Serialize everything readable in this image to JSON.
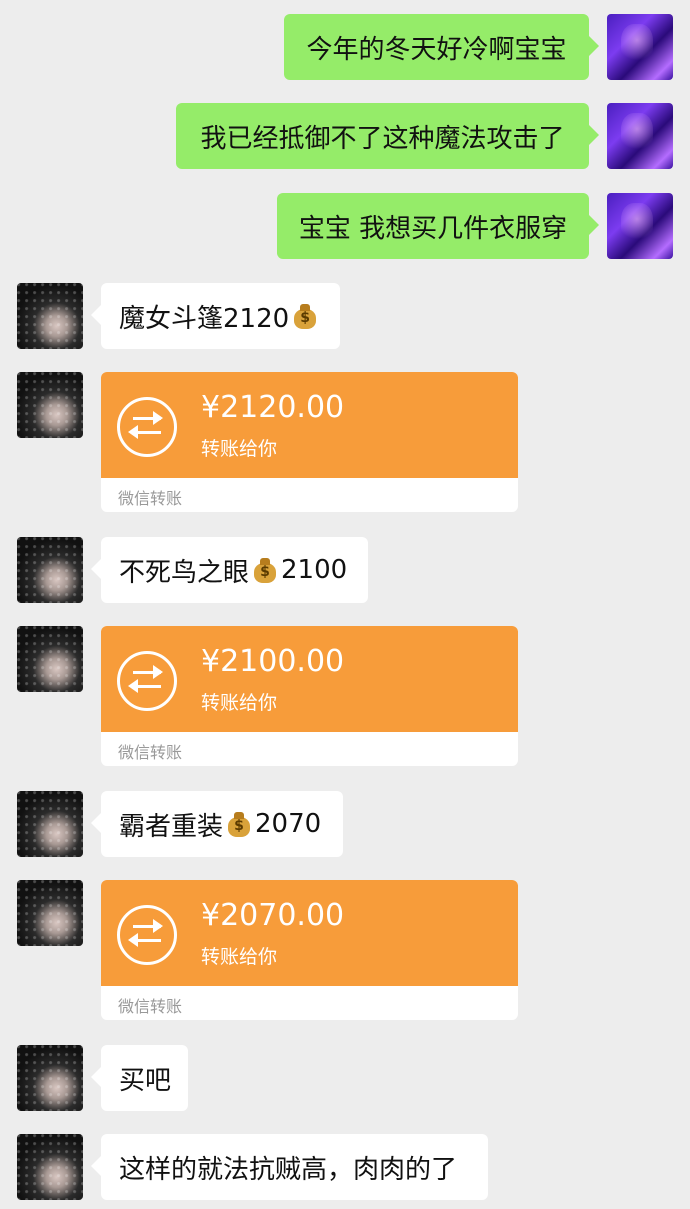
{
  "messages": [
    {
      "side": "me",
      "type": "text",
      "text": "今年的冬天好冷啊宝宝"
    },
    {
      "side": "me",
      "type": "text",
      "text": "我已经抵御不了这种魔法攻击了"
    },
    {
      "side": "me",
      "type": "text",
      "text": "宝宝 我想买几件衣服穿"
    },
    {
      "side": "friend",
      "type": "text",
      "prefix": "魔女斗篷2120",
      "icon": "money-bag-icon",
      "suffix": ""
    },
    {
      "side": "friend",
      "type": "transfer",
      "amount": "¥2120.00",
      "note": "转账给你",
      "footer": "微信转账"
    },
    {
      "side": "friend",
      "type": "text",
      "prefix": "不死鸟之眼",
      "icon": "money-bag-icon",
      "suffix": "2100"
    },
    {
      "side": "friend",
      "type": "transfer",
      "amount": "¥2100.00",
      "note": "转账给你",
      "footer": "微信转账"
    },
    {
      "side": "friend",
      "type": "text",
      "prefix": "霸者重装",
      "icon": "money-bag-icon",
      "suffix": "2070"
    },
    {
      "side": "friend",
      "type": "transfer",
      "amount": "¥2070.00",
      "note": "转账给你",
      "footer": "微信转账"
    },
    {
      "side": "friend",
      "type": "text",
      "prefix": "买吧"
    },
    {
      "side": "friend",
      "type": "text",
      "prefix": "这样的就法抗贼高，肉肉的了"
    }
  ],
  "colors": {
    "background": "#ededed",
    "sent_bubble": "#95ec69",
    "received_bubble": "#ffffff",
    "transfer": "#f79c3a"
  }
}
